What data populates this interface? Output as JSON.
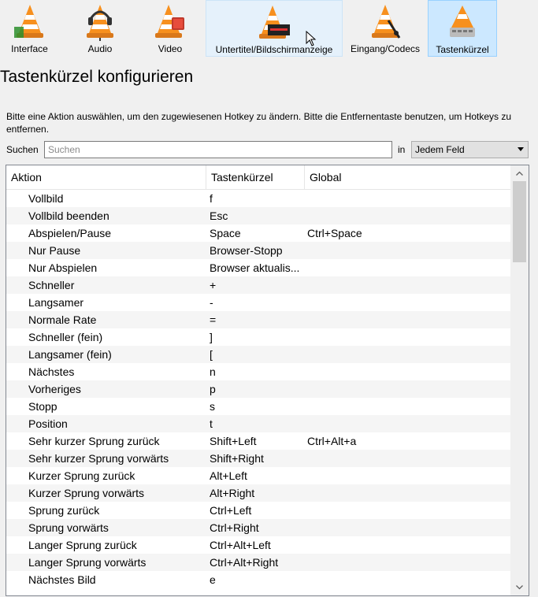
{
  "toolbar": {
    "items": [
      {
        "label": "Interface",
        "icon": "interface-cone-icon"
      },
      {
        "label": "Audio",
        "icon": "audio-cone-icon"
      },
      {
        "label": "Video",
        "icon": "video-cone-icon"
      },
      {
        "label": "Untertitel/Bildschirmanzeige",
        "icon": "subtitles-cone-icon"
      },
      {
        "label": "Eingang/Codecs",
        "icon": "input-codecs-cone-icon"
      },
      {
        "label": "Tastenkürzel",
        "icon": "hotkeys-cone-icon"
      }
    ],
    "active": "Tastenkürzel"
  },
  "header": {
    "title": "Tastenkürzel konfigurieren",
    "hint": "Bitte eine Aktion auswählen, um den zugewiesenen Hotkey zu ändern. Bitte die Entfernentaste benutzen, um Hotkeys zu entfernen."
  },
  "search": {
    "label": "Suchen",
    "placeholder": "Suchen",
    "value": "",
    "in_label": "in",
    "field": "Jedem Feld"
  },
  "table": {
    "columns": [
      "Aktion",
      "Tastenkürzel",
      "Global"
    ],
    "rows": [
      {
        "action": "Vollbild",
        "hotkey": "f",
        "global": ""
      },
      {
        "action": "Vollbild beenden",
        "hotkey": "Esc",
        "global": ""
      },
      {
        "action": "Abspielen/Pause",
        "hotkey": "Space",
        "global": "Ctrl+Space"
      },
      {
        "action": "Nur Pause",
        "hotkey": "Browser-Stopp",
        "global": ""
      },
      {
        "action": "Nur Abspielen",
        "hotkey": "Browser aktualis...",
        "global": ""
      },
      {
        "action": "Schneller",
        "hotkey": "+",
        "global": ""
      },
      {
        "action": "Langsamer",
        "hotkey": "-",
        "global": ""
      },
      {
        "action": "Normale Rate",
        "hotkey": "=",
        "global": ""
      },
      {
        "action": "Schneller (fein)",
        "hotkey": "]",
        "global": ""
      },
      {
        "action": "Langsamer (fein)",
        "hotkey": "[",
        "global": ""
      },
      {
        "action": "Nächstes",
        "hotkey": "n",
        "global": ""
      },
      {
        "action": "Vorheriges",
        "hotkey": "p",
        "global": ""
      },
      {
        "action": "Stopp",
        "hotkey": "s",
        "global": ""
      },
      {
        "action": "Position",
        "hotkey": "t",
        "global": ""
      },
      {
        "action": "Sehr kurzer Sprung zurück",
        "hotkey": "Shift+Left",
        "global": "Ctrl+Alt+a"
      },
      {
        "action": "Sehr kurzer Sprung vorwärts",
        "hotkey": "Shift+Right",
        "global": ""
      },
      {
        "action": "Kurzer Sprung zurück",
        "hotkey": "Alt+Left",
        "global": ""
      },
      {
        "action": "Kurzer Sprung vorwärts",
        "hotkey": "Alt+Right",
        "global": ""
      },
      {
        "action": "Sprung zurück",
        "hotkey": "Ctrl+Left",
        "global": ""
      },
      {
        "action": "Sprung vorwärts",
        "hotkey": "Ctrl+Right",
        "global": ""
      },
      {
        "action": "Langer Sprung zurück",
        "hotkey": "Ctrl+Alt+Left",
        "global": ""
      },
      {
        "action": "Langer Sprung vorwärts",
        "hotkey": "Ctrl+Alt+Right",
        "global": ""
      },
      {
        "action": "Nächstes Bild",
        "hotkey": "e",
        "global": ""
      }
    ]
  },
  "colors": {
    "cone_orange": "#f7901e",
    "cone_white": "#ffffff",
    "active_tab_bg": "#cce8ff",
    "hover_tab_bg": "#e5f1fb"
  }
}
